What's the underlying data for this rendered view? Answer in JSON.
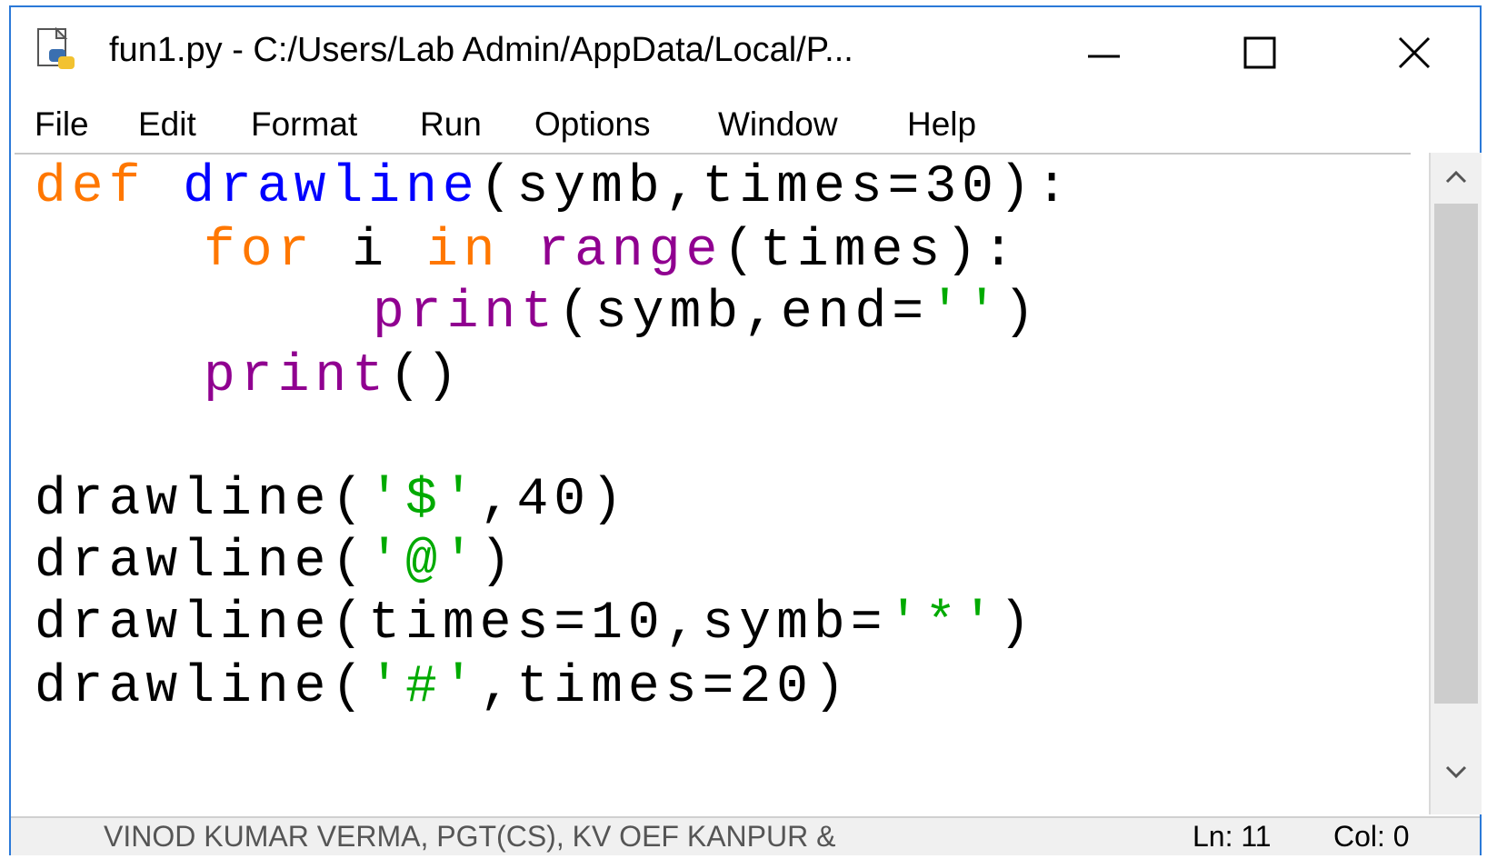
{
  "window": {
    "title": "fun1.py - C:/Users/Lab Admin/AppData/Local/P..."
  },
  "menu": {
    "file": "File",
    "edit": "Edit",
    "format": "Format",
    "run": "Run",
    "options": "Options",
    "window": "Window",
    "help": "Help"
  },
  "code": {
    "line1": {
      "kw": "def",
      "name": "drawline",
      "rest": "(symb,times=30):"
    },
    "line2": {
      "kw_for": "for",
      "var": " i ",
      "kw_in": "in",
      "space": " ",
      "bi": "range",
      "rest": "(times):"
    },
    "line3": {
      "bi": "print",
      "before": "(symb,end=",
      "str": "''",
      "after": ")"
    },
    "line4": {
      "bi": "print",
      "rest": "()"
    },
    "line6": {
      "name": "drawline(",
      "str": "'$'",
      "rest": ",40)"
    },
    "line7": {
      "name": "drawline(",
      "str": "'@'",
      "rest": ")"
    },
    "line8": {
      "name": "drawline(times=10,symb=",
      "str": "'*'",
      "rest": ")"
    },
    "line9": {
      "name": "drawline(",
      "str": "'#'",
      "rest": ",times=20)"
    }
  },
  "status": {
    "credit": "VINOD KUMAR VERMA, PGT(CS), KV OEF KANPUR &",
    "ln": "Ln: 11",
    "col": "Col: 0"
  },
  "colors": {
    "keyword": "#ff7700",
    "definition": "#0000ff",
    "builtin": "#900090",
    "string": "#00aa00",
    "window_border": "#2b79d8"
  }
}
